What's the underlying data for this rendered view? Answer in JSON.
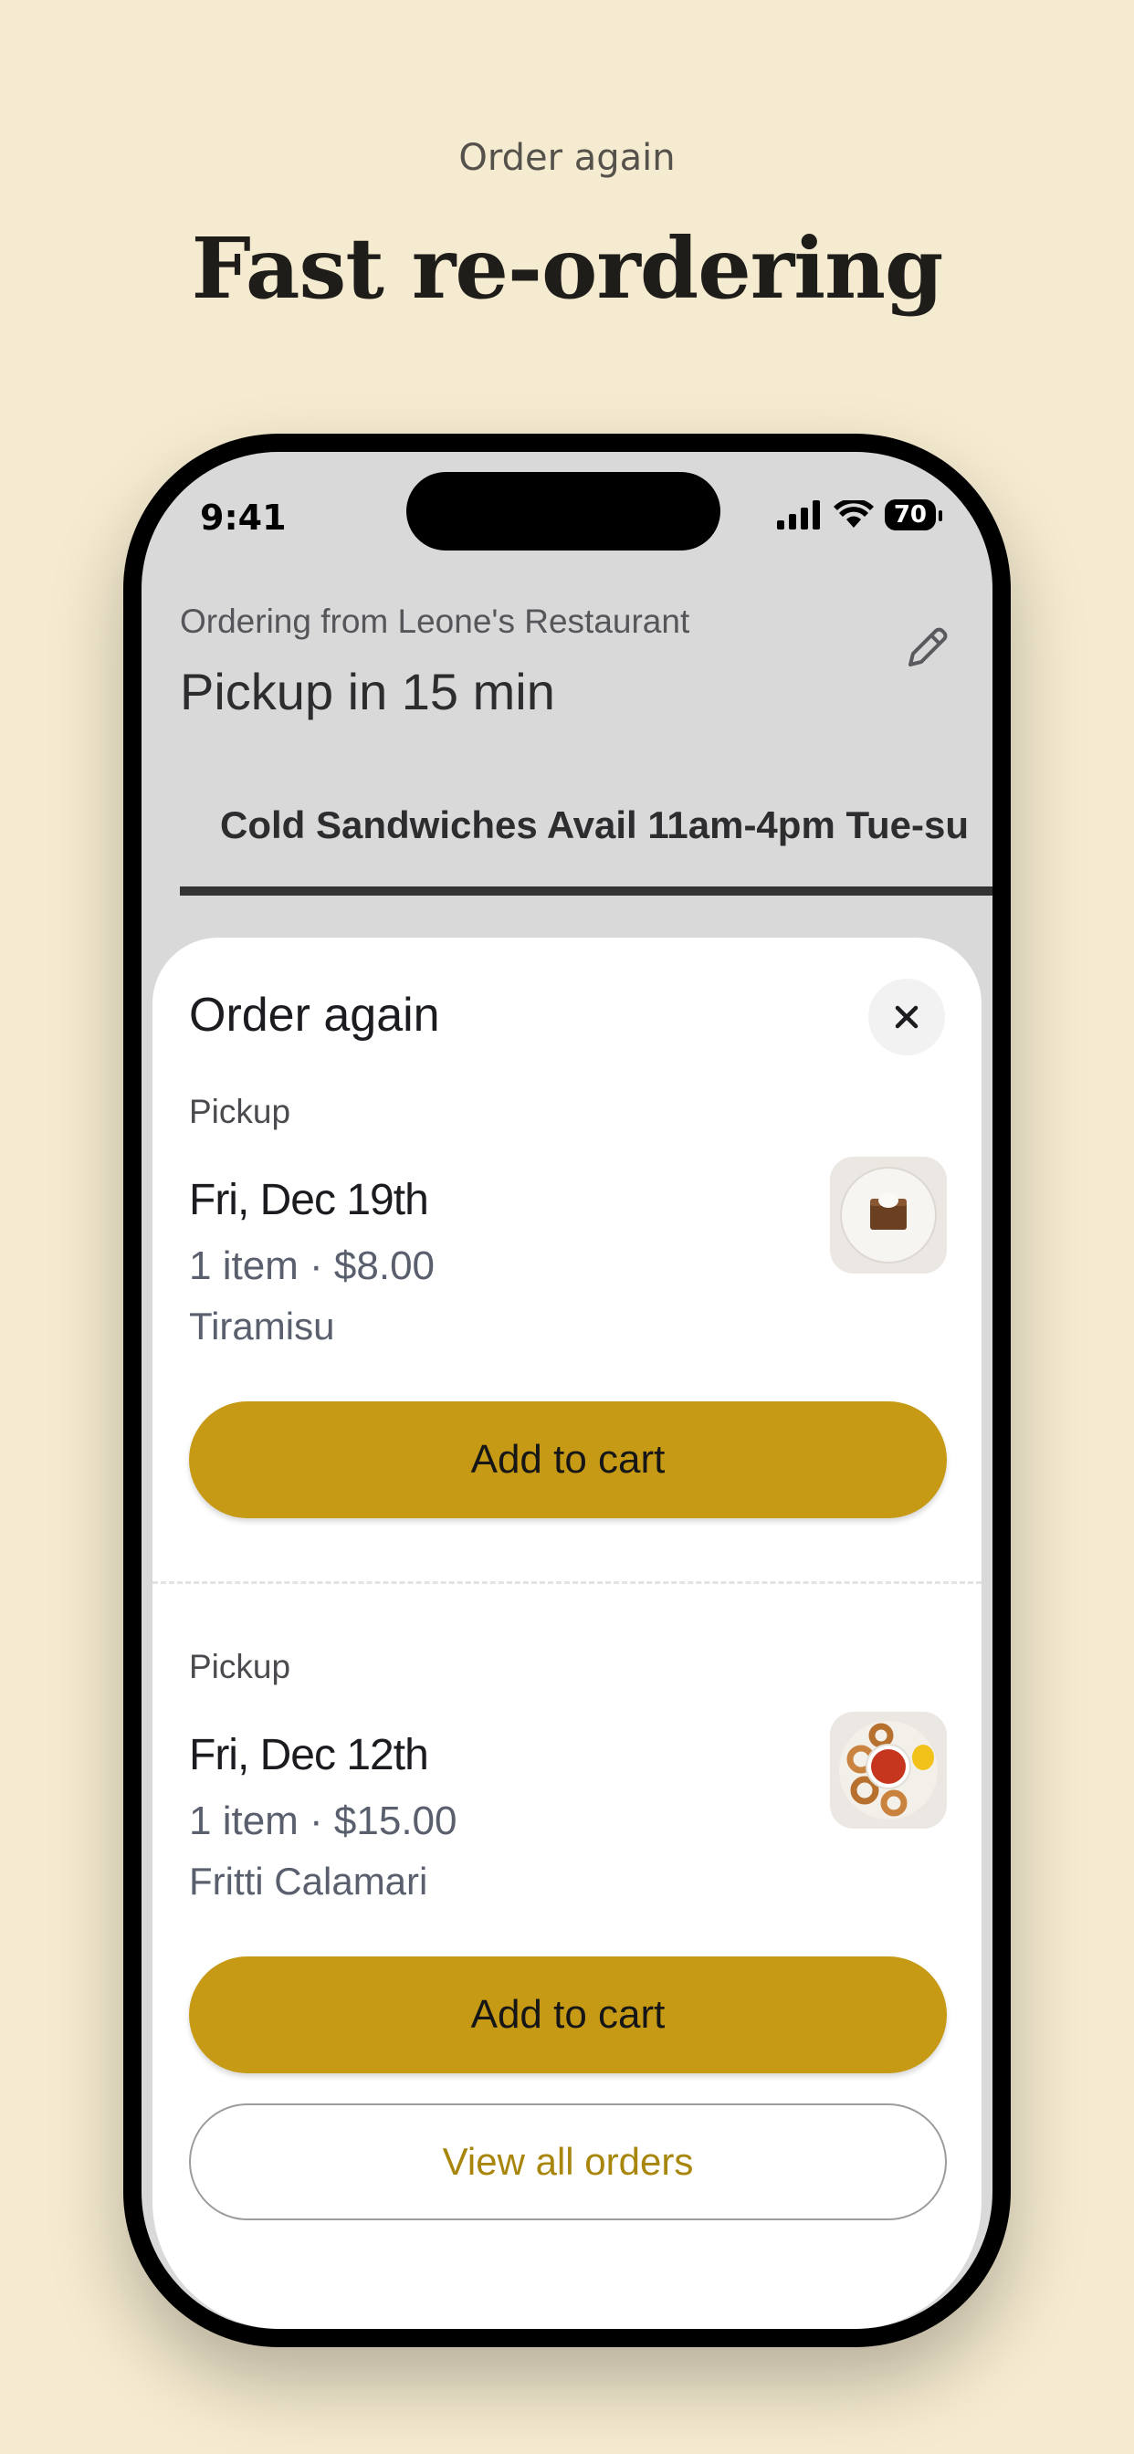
{
  "page": {
    "kicker": "Order again",
    "headline": "Fast re-ordering"
  },
  "status_bar": {
    "time": "9:41",
    "battery": "70"
  },
  "header": {
    "ordering_from": "Ordering from Leone's Restaurant",
    "pickup_time": "Pickup in 15 min",
    "active_tab": "Cold Sandwiches Avail 11am-4pm Tue-su"
  },
  "sheet": {
    "title": "Order again",
    "orders": [
      {
        "type": "Pickup",
        "date": "Fri, Dec 19th",
        "summary": "1 item · $8.00",
        "item": "Tiramisu",
        "button": "Add to cart"
      },
      {
        "type": "Pickup",
        "date": "Fri, Dec 12th",
        "summary": "1 item · $15.00",
        "item": "Fritti Calamari",
        "button": "Add to cart"
      }
    ],
    "view_all": "View all orders"
  },
  "colors": {
    "accent": "#c69a14",
    "background": "#f5ebd0",
    "link": "#a8850b"
  }
}
